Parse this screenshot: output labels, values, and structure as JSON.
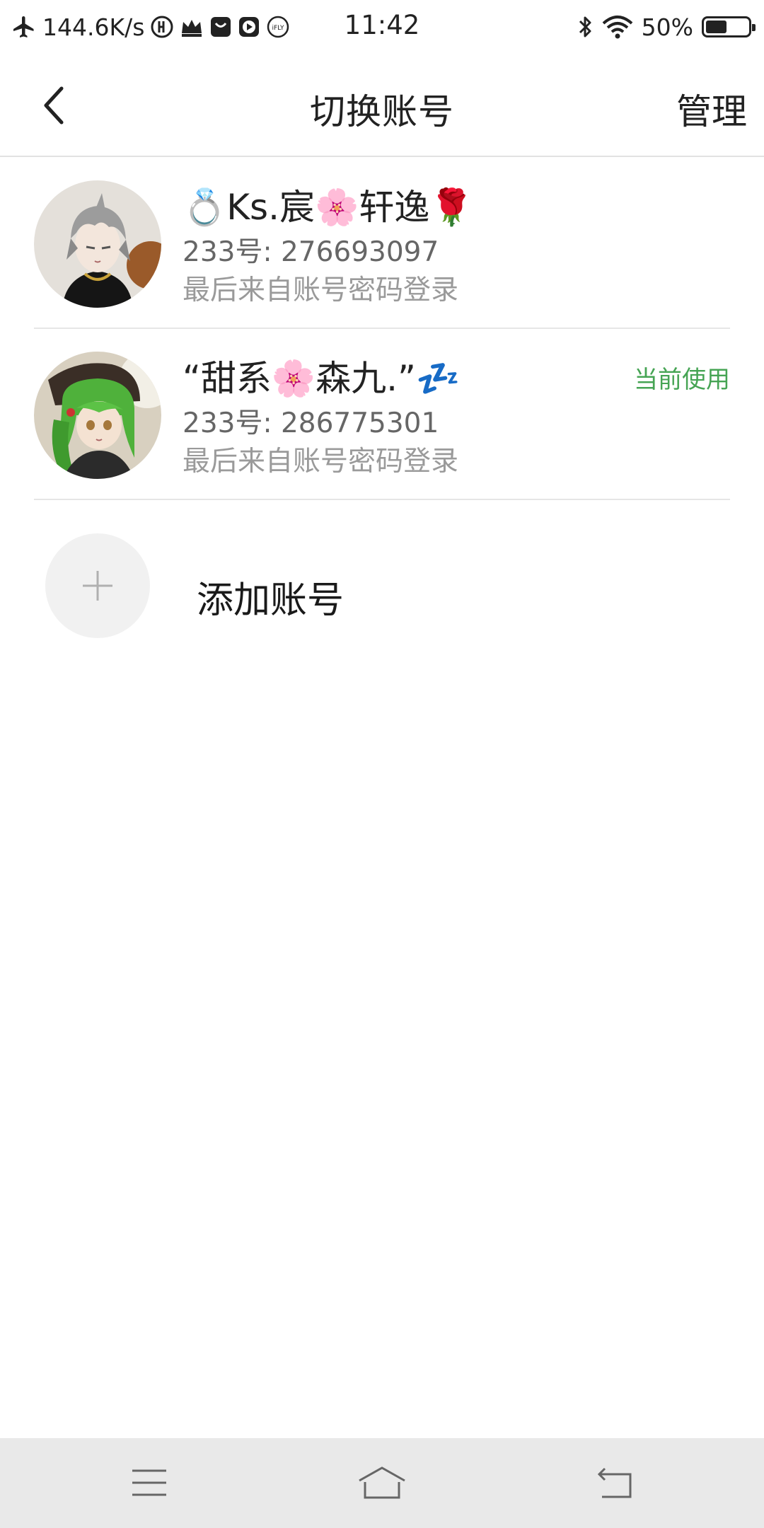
{
  "status_bar": {
    "network_speed": "144.6K/s",
    "time": "11:42",
    "battery_percent": "50%",
    "battery_level": 0.5
  },
  "header": {
    "title": "切换账号",
    "manage_label": "管理"
  },
  "accounts": [
    {
      "name": "💍Ks.宸🌸轩逸🌹",
      "id_line": "233号: 276693097",
      "login_meta": "最后来自账号密码登录",
      "current_label": ""
    },
    {
      "name": "“甜系🌸森九.”💤",
      "id_line": "233号: 286775301",
      "login_meta": "最后来自账号密码登录",
      "current_label": "当前使用"
    }
  ],
  "add_account": {
    "label": "添加账号"
  },
  "colors": {
    "accent_green": "#46a454",
    "divider": "#e6e6e6",
    "navbar_bg": "#e9e9e9"
  },
  "icons": [
    "airplane-icon",
    "wifi-icon",
    "bluetooth-icon",
    "battery-icon",
    "back-chevron-icon",
    "plus-icon",
    "menu-icon",
    "home-icon",
    "return-icon"
  ]
}
